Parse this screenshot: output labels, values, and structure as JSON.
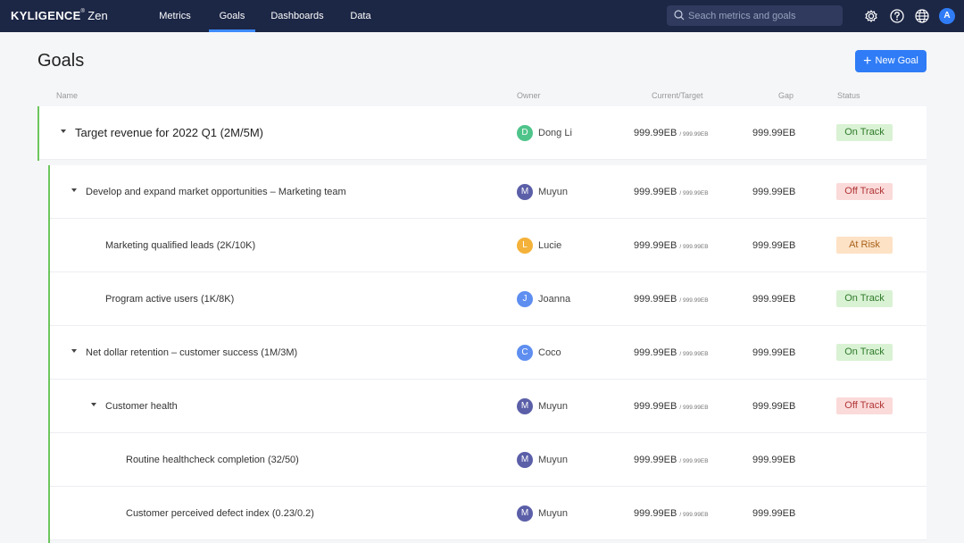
{
  "app": {
    "brand": "KYLIGENCE",
    "brand_mark": "®",
    "product": "Zen"
  },
  "nav": [
    {
      "label": "Metrics",
      "active": false
    },
    {
      "label": "Goals",
      "active": true
    },
    {
      "label": "Dashboards",
      "active": false
    },
    {
      "label": "Data",
      "active": false
    }
  ],
  "search": {
    "placeholder": "Seach metrics and goals"
  },
  "user": {
    "initial": "A"
  },
  "page": {
    "title": "Goals",
    "new_goal_label": "New Goal"
  },
  "columns": {
    "name": "Name",
    "owner": "Owner",
    "current_target": "Current/Target",
    "gap": "Gap",
    "status": "Status"
  },
  "colors": {
    "accent": "#2f7cf6",
    "topbar": "#1c2645",
    "tree_line": "#6cc65c",
    "on_track": "#2f7a2a",
    "off_track": "#b03535",
    "at_risk": "#a8611b"
  },
  "rows": [
    {
      "name": "Target revenue for 2022 Q1 (2M/5M)",
      "owner": {
        "initial": "D",
        "name": "Dong Li",
        "color": "#4fc48a"
      },
      "current": "999.99EB",
      "target": "/ 999.99EB",
      "gap": "999.99EB",
      "status": "On Track"
    },
    {
      "name": "Develop and expand market opportunities – Marketing team",
      "owner": {
        "initial": "M",
        "name": "Muyun",
        "color": "#5b5fa8"
      },
      "current": "999.99EB",
      "target": "/ 999.99EB",
      "gap": "999.99EB",
      "status": "Off Track"
    },
    {
      "name": "Marketing qualified leads (2K/10K)",
      "owner": {
        "initial": "L",
        "name": "Lucie",
        "color": "#f4b23a"
      },
      "current": "999.99EB",
      "target": "/ 999.99EB",
      "gap": "999.99EB",
      "status": "At Risk"
    },
    {
      "name": "Program active users (1K/8K)",
      "owner": {
        "initial": "J",
        "name": "Joanna",
        "color": "#5e8ef0"
      },
      "current": "999.99EB",
      "target": "/ 999.99EB",
      "gap": "999.99EB",
      "status": "On Track"
    },
    {
      "name": "Net dollar retention – customer success (1M/3M)",
      "owner": {
        "initial": "C",
        "name": "Coco",
        "color": "#5e8ef0"
      },
      "current": "999.99EB",
      "target": "/ 999.99EB",
      "gap": "999.99EB",
      "status": "On Track"
    },
    {
      "name": "Customer health",
      "owner": {
        "initial": "M",
        "name": "Muyun",
        "color": "#5b5fa8"
      },
      "current": "999.99EB",
      "target": "/ 999.99EB",
      "gap": "999.99EB",
      "status": "Off Track"
    },
    {
      "name": "Routine healthcheck completion (32/50)",
      "owner": {
        "initial": "M",
        "name": "Muyun",
        "color": "#5b5fa8"
      },
      "current": "999.99EB",
      "target": "/ 999.99EB",
      "gap": "999.99EB",
      "status": ""
    },
    {
      "name": "Customer perceived defect index (0.23/0.2)",
      "owner": {
        "initial": "M",
        "name": "Muyun",
        "color": "#5b5fa8"
      },
      "current": "999.99EB",
      "target": "/ 999.99EB",
      "gap": "999.99EB",
      "status": ""
    }
  ]
}
